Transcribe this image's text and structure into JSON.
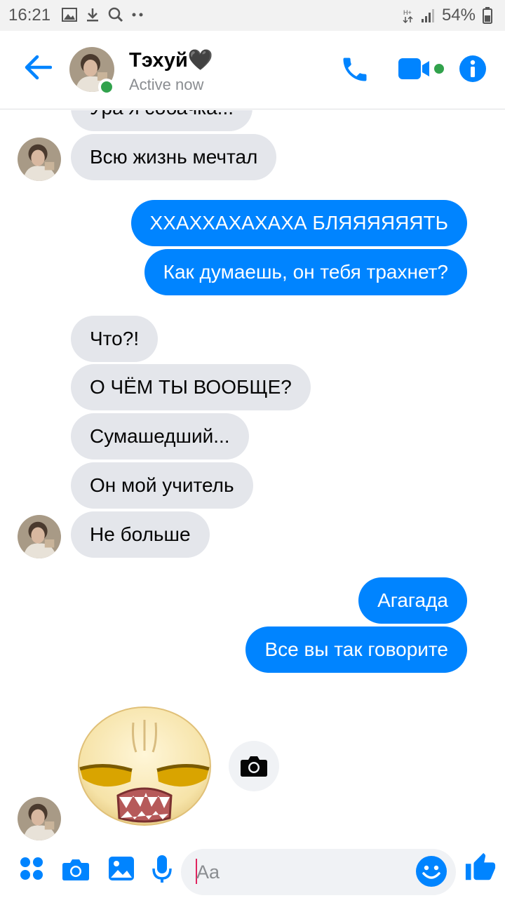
{
  "status_bar": {
    "time": "16:21",
    "battery": "54%",
    "icons": [
      "image-icon",
      "download-icon",
      "search-icon",
      "more-dots-icon",
      "data-icon",
      "signal-icon",
      "battery-icon"
    ]
  },
  "header": {
    "contact_name": "Тэхуй🖤",
    "status": "Active now",
    "icons": [
      "back-arrow-icon",
      "phone-icon",
      "video-icon",
      "info-icon"
    ]
  },
  "messages": [
    {
      "side": "in",
      "text": "Ура я собачка..."
    },
    {
      "side": "in",
      "text": "Всю жизнь мечтал"
    },
    {
      "side": "out",
      "text": "ХХАХХАХАХАХА БЛЯЯЯЯЯЯТЬ"
    },
    {
      "side": "out",
      "text": "Как думаешь, он тебя трахнет?"
    },
    {
      "side": "in",
      "text": "Что?!"
    },
    {
      "side": "in",
      "text": "О ЧЁМ ТЫ ВООБЩЕ?"
    },
    {
      "side": "in",
      "text": "Сумашедший..."
    },
    {
      "side": "in",
      "text": "Он мой учитель"
    },
    {
      "side": "in",
      "text": "Не больше"
    },
    {
      "side": "out",
      "text": "Агагада"
    },
    {
      "side": "out",
      "text": "Все вы так говорите"
    }
  ],
  "sticker": {
    "name": "grumpy-face-sticker"
  },
  "composer": {
    "placeholder": "Aa",
    "icons": [
      "apps-icon",
      "camera-icon",
      "gallery-icon",
      "mic-icon",
      "emoji-icon",
      "thumbs-up-icon"
    ]
  },
  "colors": {
    "accent": "#0084ff",
    "incoming_bubble": "#e4e6eb",
    "online": "#31a24c"
  }
}
